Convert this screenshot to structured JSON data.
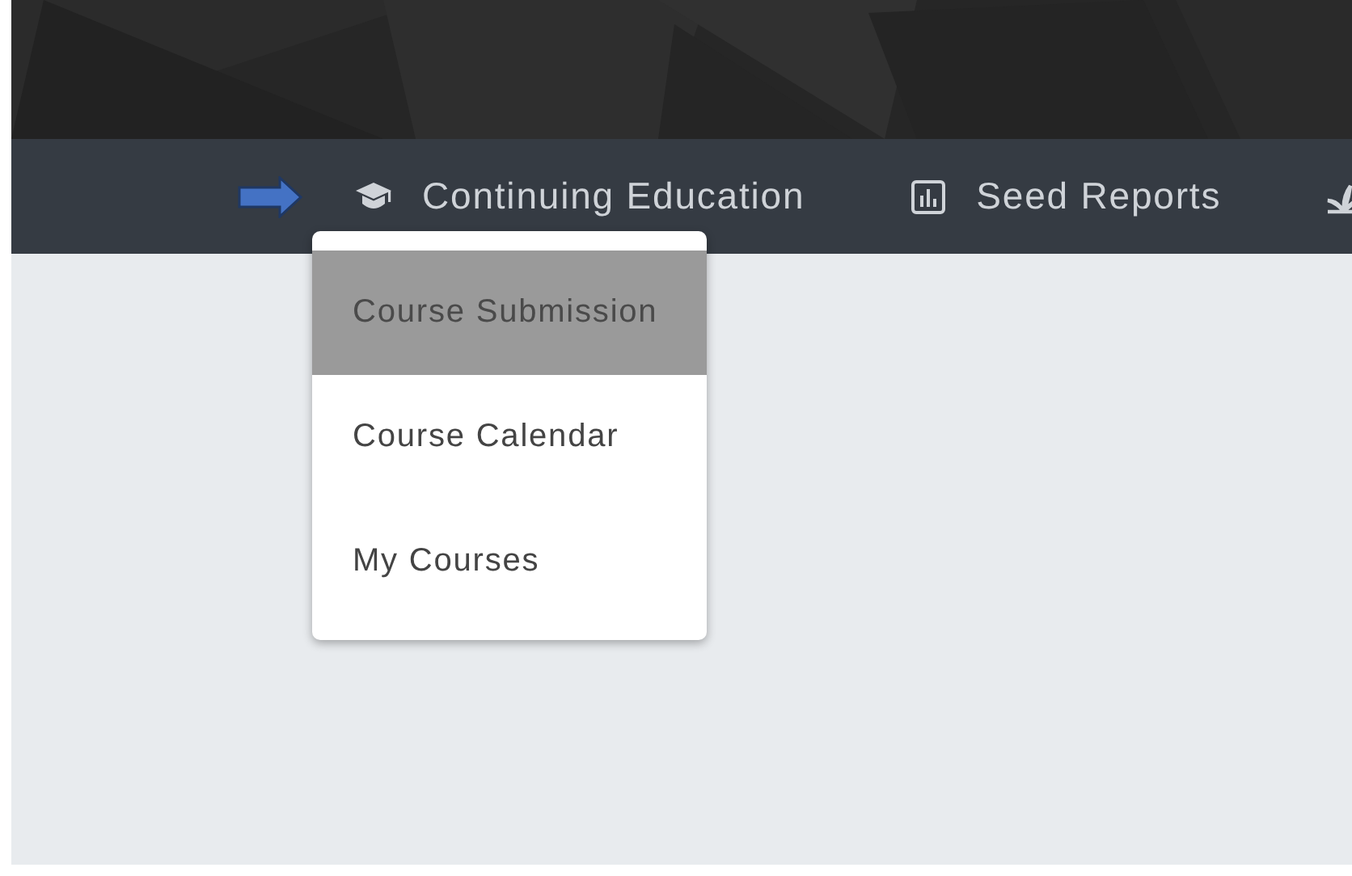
{
  "nav": {
    "items": [
      {
        "label": "Continuing Education"
      },
      {
        "label": "Seed Reports"
      }
    ]
  },
  "dropdown": {
    "items": [
      {
        "label": "Course Submission",
        "selected": true
      },
      {
        "label": "Course Calendar",
        "selected": false
      },
      {
        "label": "My Courses",
        "selected": false
      }
    ]
  }
}
